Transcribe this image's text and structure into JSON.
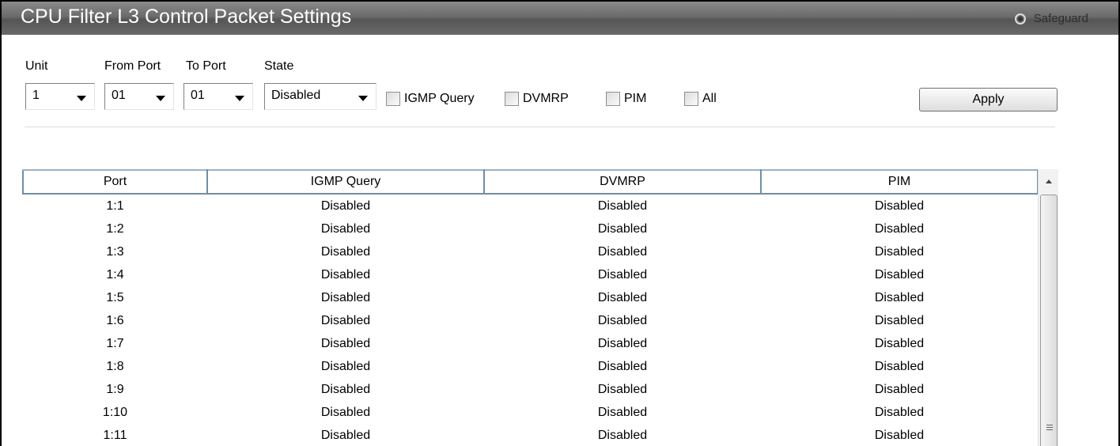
{
  "header": {
    "title": "CPU Filter L3 Control Packet Settings",
    "safeguard_label": "Safeguard"
  },
  "form": {
    "labels": {
      "unit": "Unit",
      "from_port": "From Port",
      "to_port": "To Port",
      "state": "State"
    },
    "unit_value": "1",
    "from_port_value": "01",
    "to_port_value": "01",
    "state_value": "Disabled",
    "checkboxes": {
      "igmp_query": "IGMP Query",
      "dvmrp": "DVMRP",
      "pim": "PIM",
      "all": "All"
    },
    "apply_label": "Apply"
  },
  "table": {
    "columns": [
      "Port",
      "IGMP Query",
      "DVMRP",
      "PIM"
    ],
    "rows": [
      [
        "1:1",
        "Disabled",
        "Disabled",
        "Disabled"
      ],
      [
        "1:2",
        "Disabled",
        "Disabled",
        "Disabled"
      ],
      [
        "1:3",
        "Disabled",
        "Disabled",
        "Disabled"
      ],
      [
        "1:4",
        "Disabled",
        "Disabled",
        "Disabled"
      ],
      [
        "1:5",
        "Disabled",
        "Disabled",
        "Disabled"
      ],
      [
        "1:6",
        "Disabled",
        "Disabled",
        "Disabled"
      ],
      [
        "1:7",
        "Disabled",
        "Disabled",
        "Disabled"
      ],
      [
        "1:8",
        "Disabled",
        "Disabled",
        "Disabled"
      ],
      [
        "1:9",
        "Disabled",
        "Disabled",
        "Disabled"
      ],
      [
        "1:10",
        "Disabled",
        "Disabled",
        "Disabled"
      ],
      [
        "1:11",
        "Disabled",
        "Disabled",
        "Disabled"
      ]
    ]
  },
  "icons": {
    "safeguard": "safeguard-status-icon",
    "dropdown": "chevron-down-icon",
    "scroll_up": "scroll-up-arrow-icon"
  }
}
